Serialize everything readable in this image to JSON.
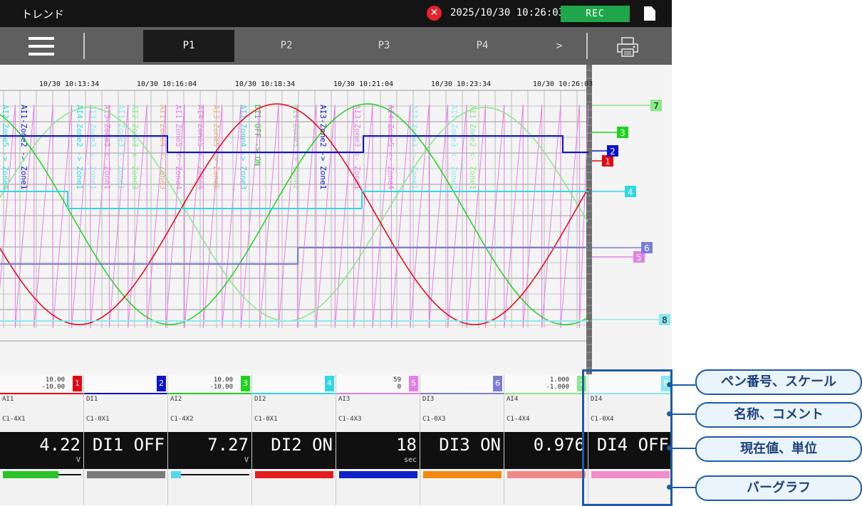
{
  "titlebar": {
    "title": "トレンド",
    "error_icon": "close-circle-icon",
    "error_glyph": "✕",
    "datetime": "2025/10/30 10:26:03",
    "rec_label": "REC",
    "file_icon": "file-icon"
  },
  "navbar": {
    "menu_icon": "hamburger-menu-icon",
    "tabs": [
      {
        "label": "P1",
        "active": true
      },
      {
        "label": "P2",
        "active": false
      },
      {
        "label": "P3",
        "active": false
      },
      {
        "label": "P4",
        "active": false
      }
    ],
    "more_label": ">",
    "print_icon": "printer-icon"
  },
  "trend": {
    "time_labels": [
      "10/30 10:13:34",
      "10/30 10:16:04",
      "10/30 10:18:34",
      "10/30 10:21:04",
      "10/30 10:23:34",
      "10/30 10:26:03"
    ],
    "pen_markers": [
      {
        "num": "1",
        "color": "#e60012"
      },
      {
        "num": "2",
        "color": "#0a14c8"
      },
      {
        "num": "3",
        "color": "#1ed31e"
      },
      {
        "num": "4",
        "color": "#2ed8e6"
      },
      {
        "num": "5",
        "color": "#e57ee5"
      },
      {
        "num": "6",
        "color": "#7d7dd6"
      },
      {
        "num": "7",
        "color": "#88e888"
      },
      {
        "num": "8",
        "color": "#8ce8ee"
      }
    ],
    "messages": [
      {
        "text": "AI2-Zone5 -> Zone4",
        "color": "#2ed8e6"
      },
      {
        "text": "AI1-Zone2 -> Zone1",
        "color": "#0a14c8"
      },
      {
        "text": "AI4-Zone2 -> Zone1",
        "color": "#2ed8e6"
      },
      {
        "text": "AI3-Zone3 <- Zone1",
        "color": "#8ce8ee"
      },
      {
        "text": "AI3-Zone3 <- Zone1",
        "color": "#e57ee5"
      },
      {
        "text": "AI1-Zone3 <- Zone1",
        "color": "#8ce8ee"
      },
      {
        "text": "AI2-Zone3 <- Zone3",
        "color": "#88e888"
      },
      {
        "text": "AI1-Zone4 <- Zone3",
        "color": "#e8b070"
      },
      {
        "text": "AI1-Zone5 <- Zone4",
        "color": "#e57ee5"
      },
      {
        "text": "AI4-Zone5 <- Zone4",
        "color": "#e57ee5"
      },
      {
        "text": "AI3-Zone5 -> Zone6",
        "color": "#e8b070"
      },
      {
        "text": "AI1-Zone4 -> Zone3",
        "color": "#2ed8e6"
      },
      {
        "text": "DI1 OFF -> ON",
        "color": "#1ed31e"
      },
      {
        "text": "AI1-Zone3 -> Zone2",
        "color": "#88e888"
      },
      {
        "text": "AI3-Zone2 -> Zone1",
        "color": "#0a14c8"
      },
      {
        "text": "AI3-Zone3 <- Zone1",
        "color": "#e57ee5"
      },
      {
        "text": "AI4-Zone5 <- Zone4",
        "color": "#e57ee5"
      },
      {
        "text": "AI3-Zone3 <- Zone1",
        "color": "#8ce8ee"
      },
      {
        "text": "AI1-Zone3 <- Zone2",
        "color": "#8ce8ee"
      },
      {
        "text": "AI1-Zone2 <- Zone1",
        "color": "#88e888"
      }
    ]
  },
  "pens": [
    {
      "num": "1",
      "color": "#e60012",
      "scale_top": "10.00",
      "scale_bottom": "-10.00",
      "name": "AI1",
      "comment": "C1-4X1",
      "value": "4.22",
      "unit": "V",
      "bar_color": "#29c229",
      "bar_fill": 0.71,
      "bar_line": true
    },
    {
      "num": "2",
      "color": "#0a14c8",
      "scale_top": "",
      "scale_bottom": "",
      "name": "DI1",
      "comment": "C1-0X1",
      "value": "DI1 OFF",
      "unit": "",
      "bar_color": "#7a7a7a",
      "bar_fill": 1.0,
      "bar_line": false
    },
    {
      "num": "3",
      "color": "#1ed31e",
      "scale_top": "10.00",
      "scale_bottom": "-10.00",
      "name": "AI2",
      "comment": "C1-4X2",
      "value": "7.27",
      "unit": "V",
      "bar_color": "#55d8e8",
      "bar_fill": 0.13,
      "bar_line": true
    },
    {
      "num": "4",
      "color": "#2ed8e6",
      "scale_top": "",
      "scale_bottom": "",
      "name": "DI2",
      "comment": "C1-0X1",
      "value": "DI2 ON",
      "unit": "",
      "bar_color": "#e41b1b",
      "bar_fill": 1.0,
      "bar_line": false
    },
    {
      "num": "5",
      "color": "#e57ee5",
      "scale_top": "59",
      "scale_bottom": "0",
      "name": "AI3",
      "comment": "C1-4X3",
      "value": "18",
      "unit": "sec",
      "bar_color": "#1020c8",
      "bar_fill": 1.0,
      "bar_line": false
    },
    {
      "num": "6",
      "color": "#7d7dd6",
      "scale_top": "",
      "scale_bottom": "",
      "name": "DI3",
      "comment": "C1-0X3",
      "value": "DI3 ON",
      "unit": "",
      "bar_color": "#f08a12",
      "bar_fill": 1.0,
      "bar_line": false
    },
    {
      "num": "7",
      "color": "#88e888",
      "scale_top": "1.000",
      "scale_bottom": "-1.000",
      "name": "AI4",
      "comment": "C1-4X4",
      "value": "0.976",
      "unit": "",
      "bar_color": "#f08888",
      "bar_fill": 1.0,
      "bar_line": false
    },
    {
      "num": "8",
      "color": "#8ce8ee",
      "scale_top": "",
      "scale_bottom": "",
      "name": "DI4",
      "comment": "C1-0X4",
      "value": "DI4 OFF",
      "unit": "",
      "bar_color": "#f08cc8",
      "bar_fill": 1.0,
      "bar_line": false
    }
  ],
  "callouts": [
    {
      "label": "ペン番号、スケール"
    },
    {
      "label": "名称、コメント"
    },
    {
      "label": "現在値、単位"
    },
    {
      "label": "バーグラフ"
    }
  ]
}
